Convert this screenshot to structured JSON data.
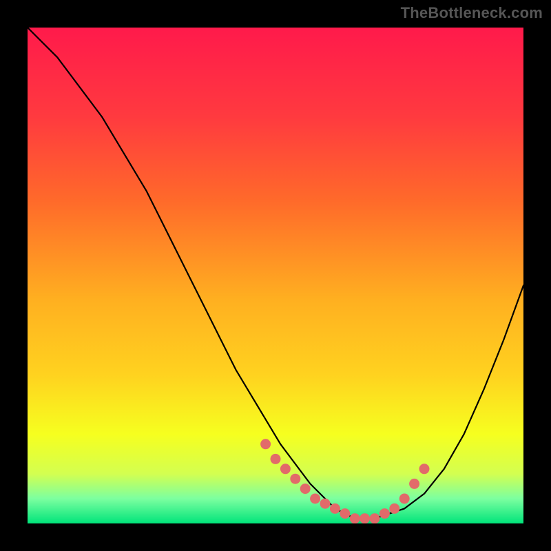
{
  "watermark": "TheBottleneck.com",
  "colors": {
    "gradient_top": "#ff1a4b",
    "gradient_mid1": "#ff6a2a",
    "gradient_mid2": "#ffd21f",
    "gradient_mid3": "#f6ff1f",
    "gradient_bottom1": "#d3ff50",
    "gradient_bottom2": "#7cffa0",
    "gradient_bottom3": "#00e47a",
    "curve": "#000000",
    "marker_fill": "#e26a6a",
    "marker_stroke": "#e26a6a"
  },
  "chart_data": {
    "type": "line",
    "title": "",
    "xlabel": "",
    "ylabel": "",
    "xlim": [
      0,
      100
    ],
    "ylim": [
      0,
      100
    ],
    "series": [
      {
        "name": "bottleneck-curve",
        "x": [
          0,
          3,
          6,
          9,
          12,
          15,
          18,
          21,
          24,
          27,
          30,
          33,
          36,
          39,
          42,
          45,
          48,
          51,
          54,
          57,
          60,
          62,
          64,
          66,
          68,
          70,
          73,
          76,
          80,
          84,
          88,
          92,
          96,
          100
        ],
        "y": [
          100,
          97,
          94,
          90,
          86,
          82,
          77,
          72,
          67,
          61,
          55,
          49,
          43,
          37,
          31,
          26,
          21,
          16,
          12,
          8,
          5,
          3,
          2,
          1,
          1,
          1,
          2,
          3,
          6,
          11,
          18,
          27,
          37,
          48
        ]
      }
    ],
    "markers": {
      "name": "highlight-points",
      "x": [
        48,
        50,
        52,
        54,
        56,
        58,
        60,
        62,
        64,
        66,
        68,
        70,
        72,
        74,
        76,
        78,
        80
      ],
      "y": [
        16,
        13,
        11,
        9,
        7,
        5,
        4,
        3,
        2,
        1,
        1,
        1,
        2,
        3,
        5,
        8,
        11
      ]
    }
  }
}
